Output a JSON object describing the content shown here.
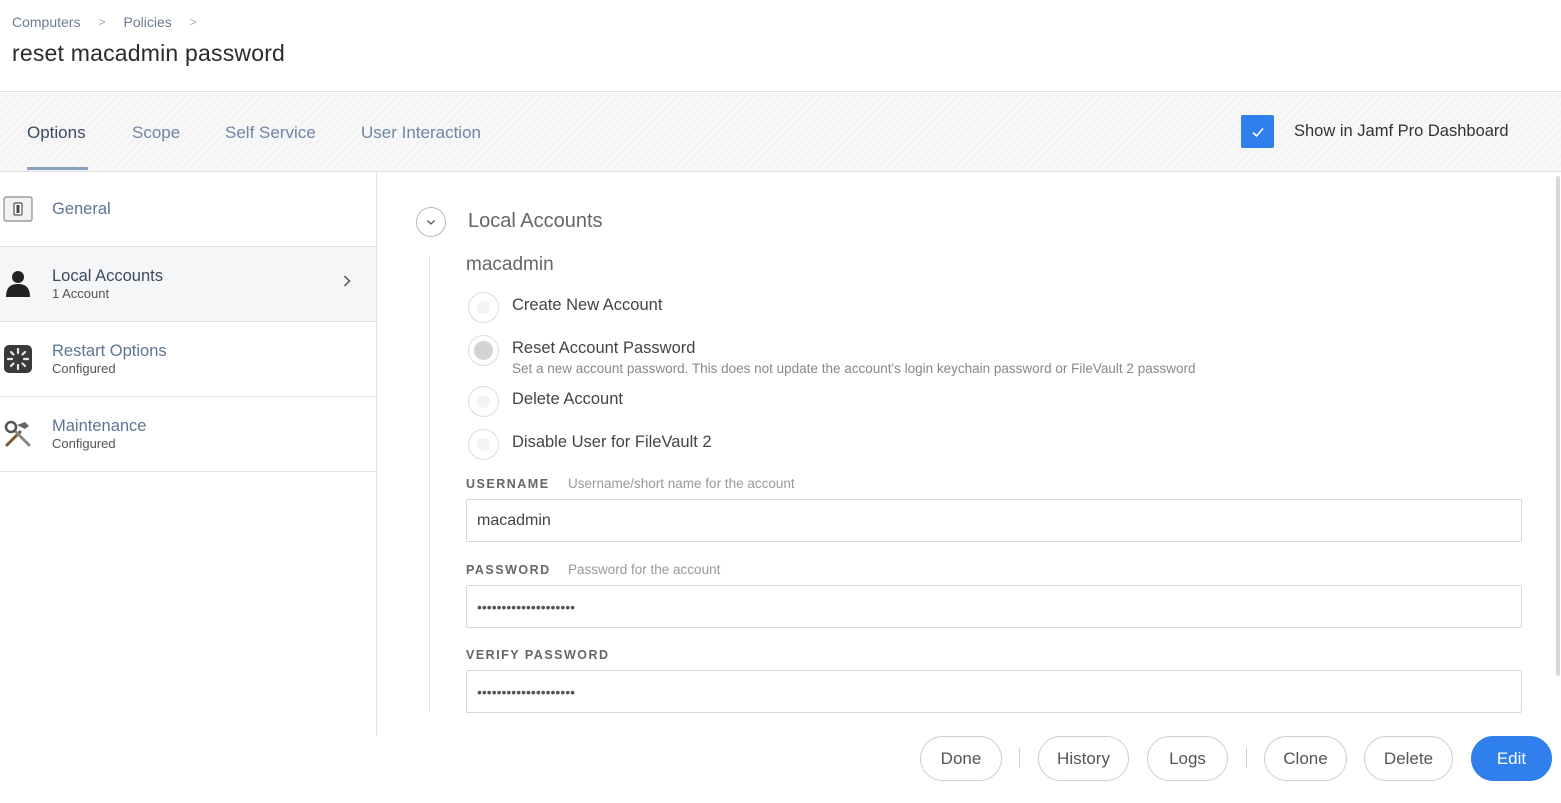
{
  "breadcrumb": {
    "items": [
      "Computers",
      "Policies"
    ],
    "separator": ">"
  },
  "page": {
    "title": "reset macadmin password"
  },
  "tabs": [
    {
      "label": "Options",
      "active": true
    },
    {
      "label": "Scope",
      "active": false
    },
    {
      "label": "Self Service",
      "active": false
    },
    {
      "label": "User Interaction",
      "active": false
    }
  ],
  "dashboard": {
    "label": "Show in Jamf Pro Dashboard",
    "checked": true
  },
  "sidebar": {
    "items": [
      {
        "title": "General",
        "subtitle": "",
        "icon": "switch-icon"
      },
      {
        "title": "Local Accounts",
        "subtitle": "1 Account",
        "icon": "user-icon",
        "active": true
      },
      {
        "title": "Restart Options",
        "subtitle": "Configured",
        "icon": "restart-icon"
      },
      {
        "title": "Maintenance",
        "subtitle": "Configured",
        "icon": "tools-icon"
      }
    ]
  },
  "main": {
    "section_title": "Local Accounts",
    "account_name": "macadmin",
    "actions": [
      {
        "label": "Create New Account",
        "description": "",
        "selected": false
      },
      {
        "label": "Reset Account Password",
        "description": "Set a new account password. This does not update the account's login keychain password or FileVault 2 password",
        "selected": true
      },
      {
        "label": "Delete Account",
        "description": "",
        "selected": false
      },
      {
        "label": "Disable User for FileVault 2",
        "description": "",
        "selected": false
      }
    ],
    "fields": {
      "username": {
        "label": "USERNAME",
        "hint": "Username/short name for the account",
        "value": "macadmin"
      },
      "password": {
        "label": "PASSWORD",
        "hint": "Password for the account",
        "value": "••••••••••••••••••••"
      },
      "verify_password": {
        "label": "VERIFY PASSWORD",
        "hint": "",
        "value": "••••••••••••••••••••"
      }
    }
  },
  "footer": {
    "buttons": [
      "Done",
      "History",
      "Logs",
      "Clone",
      "Delete",
      "Edit"
    ]
  },
  "colors": {
    "accent": "#2f80ed",
    "tab_active": "#3a4b60",
    "tab_inactive": "#6d86a3"
  }
}
